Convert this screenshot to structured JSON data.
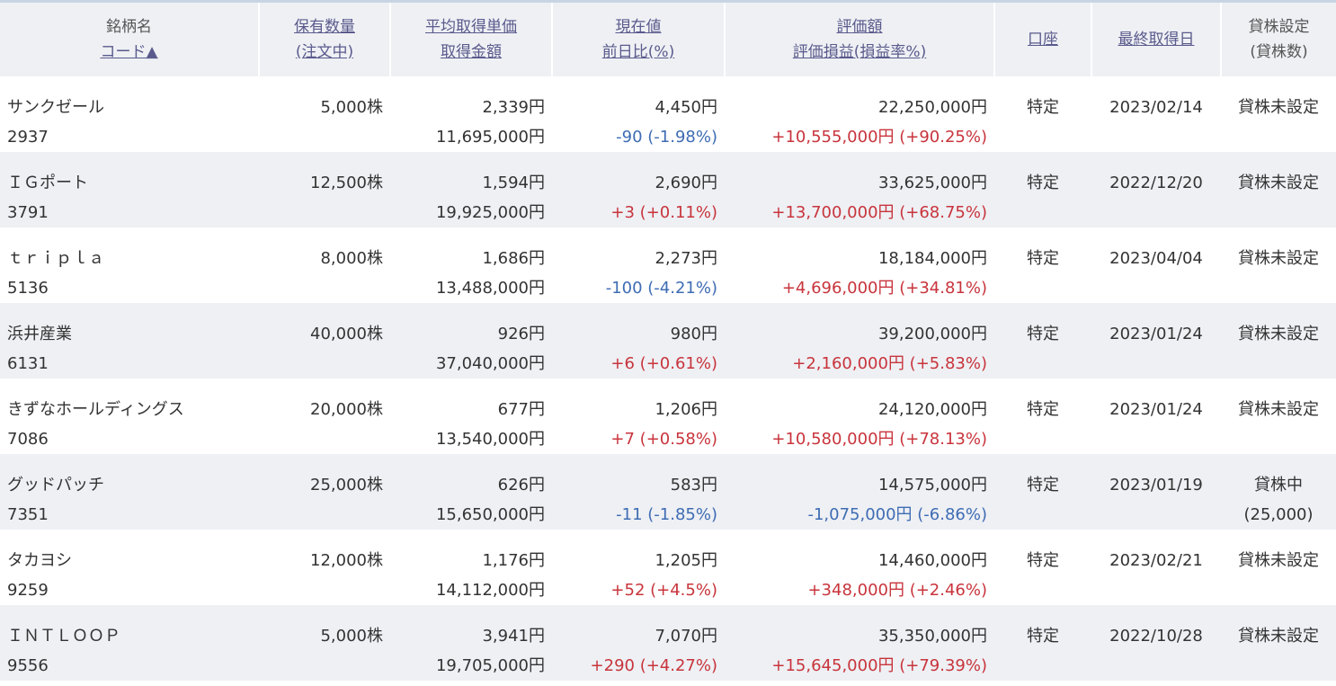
{
  "header": {
    "col1": [
      "銘柄名",
      "コード▲"
    ],
    "col2": [
      "保有数量",
      "(注文中)"
    ],
    "col3": [
      "平均取得単価",
      "取得金額"
    ],
    "col4": [
      "現在値",
      "前日比(%)"
    ],
    "col5": [
      "評価額",
      "評価損益(損益率%)"
    ],
    "col6": "口座",
    "col7": "最終取得日",
    "col8": [
      "貸株設定",
      "(貸株数)"
    ]
  },
  "rows": [
    {
      "name": "サンクゼール",
      "code": "2937",
      "qty": "5,000株",
      "avg": "2,339円",
      "cost": "11,695,000円",
      "price": "4,450円",
      "change": "-90 (-1.98%)",
      "change_sign": "neg",
      "value": "22,250,000円",
      "pl": "+10,555,000円 (+90.25%)",
      "pl_sign": "pos",
      "account": "特定",
      "date": "2023/02/14",
      "lend": "貸株未設定",
      "lend_qty": ""
    },
    {
      "name": "ＩＧポート",
      "code": "3791",
      "qty": "12,500株",
      "avg": "1,594円",
      "cost": "19,925,000円",
      "price": "2,690円",
      "change": "+3 (+0.11%)",
      "change_sign": "pos",
      "value": "33,625,000円",
      "pl": "+13,700,000円 (+68.75%)",
      "pl_sign": "pos",
      "account": "特定",
      "date": "2022/12/20",
      "lend": "貸株未設定",
      "lend_qty": ""
    },
    {
      "name": "ｔｒｉｐｌａ",
      "code": "5136",
      "qty": "8,000株",
      "avg": "1,686円",
      "cost": "13,488,000円",
      "price": "2,273円",
      "change": "-100 (-4.21%)",
      "change_sign": "neg",
      "value": "18,184,000円",
      "pl": "+4,696,000円 (+34.81%)",
      "pl_sign": "pos",
      "account": "特定",
      "date": "2023/04/04",
      "lend": "貸株未設定",
      "lend_qty": ""
    },
    {
      "name": "浜井産業",
      "code": "6131",
      "qty": "40,000株",
      "avg": "926円",
      "cost": "37,040,000円",
      "price": "980円",
      "change": "+6 (+0.61%)",
      "change_sign": "pos",
      "value": "39,200,000円",
      "pl": "+2,160,000円 (+5.83%)",
      "pl_sign": "pos",
      "account": "特定",
      "date": "2023/01/24",
      "lend": "貸株未設定",
      "lend_qty": ""
    },
    {
      "name": "きずなホールディングス",
      "code": "7086",
      "qty": "20,000株",
      "avg": "677円",
      "cost": "13,540,000円",
      "price": "1,206円",
      "change": "+7 (+0.58%)",
      "change_sign": "pos",
      "value": "24,120,000円",
      "pl": "+10,580,000円 (+78.13%)",
      "pl_sign": "pos",
      "account": "特定",
      "date": "2023/01/24",
      "lend": "貸株未設定",
      "lend_qty": ""
    },
    {
      "name": "グッドパッチ",
      "code": "7351",
      "qty": "25,000株",
      "avg": "626円",
      "cost": "15,650,000円",
      "price": "583円",
      "change": "-11 (-1.85%)",
      "change_sign": "neg",
      "value": "14,575,000円",
      "pl": "-1,075,000円 (-6.86%)",
      "pl_sign": "neg",
      "account": "特定",
      "date": "2023/01/19",
      "lend": "貸株中",
      "lend_qty": "(25,000)"
    },
    {
      "name": "タカヨシ",
      "code": "9259",
      "qty": "12,000株",
      "avg": "1,176円",
      "cost": "14,112,000円",
      "price": "1,205円",
      "change": "+52 (+4.5%)",
      "change_sign": "pos",
      "value": "14,460,000円",
      "pl": "+348,000円 (+2.46%)",
      "pl_sign": "pos",
      "account": "特定",
      "date": "2023/02/21",
      "lend": "貸株未設定",
      "lend_qty": ""
    },
    {
      "name": "ＩＮＴＬＯＯＰ",
      "code": "9556",
      "qty": "5,000株",
      "avg": "3,941円",
      "cost": "19,705,000円",
      "price": "7,070円",
      "change": "+290 (+4.27%)",
      "change_sign": "pos",
      "value": "35,350,000円",
      "pl": "+15,645,000円 (+79.39%)",
      "pl_sign": "pos",
      "account": "特定",
      "date": "2022/10/28",
      "lend": "貸株未設定",
      "lend_qty": ""
    }
  ],
  "colors": {
    "positive": "#c8343c",
    "negative": "#3e6cb3",
    "header_bg": "#eef0f4",
    "link": "#5a5a8c"
  }
}
